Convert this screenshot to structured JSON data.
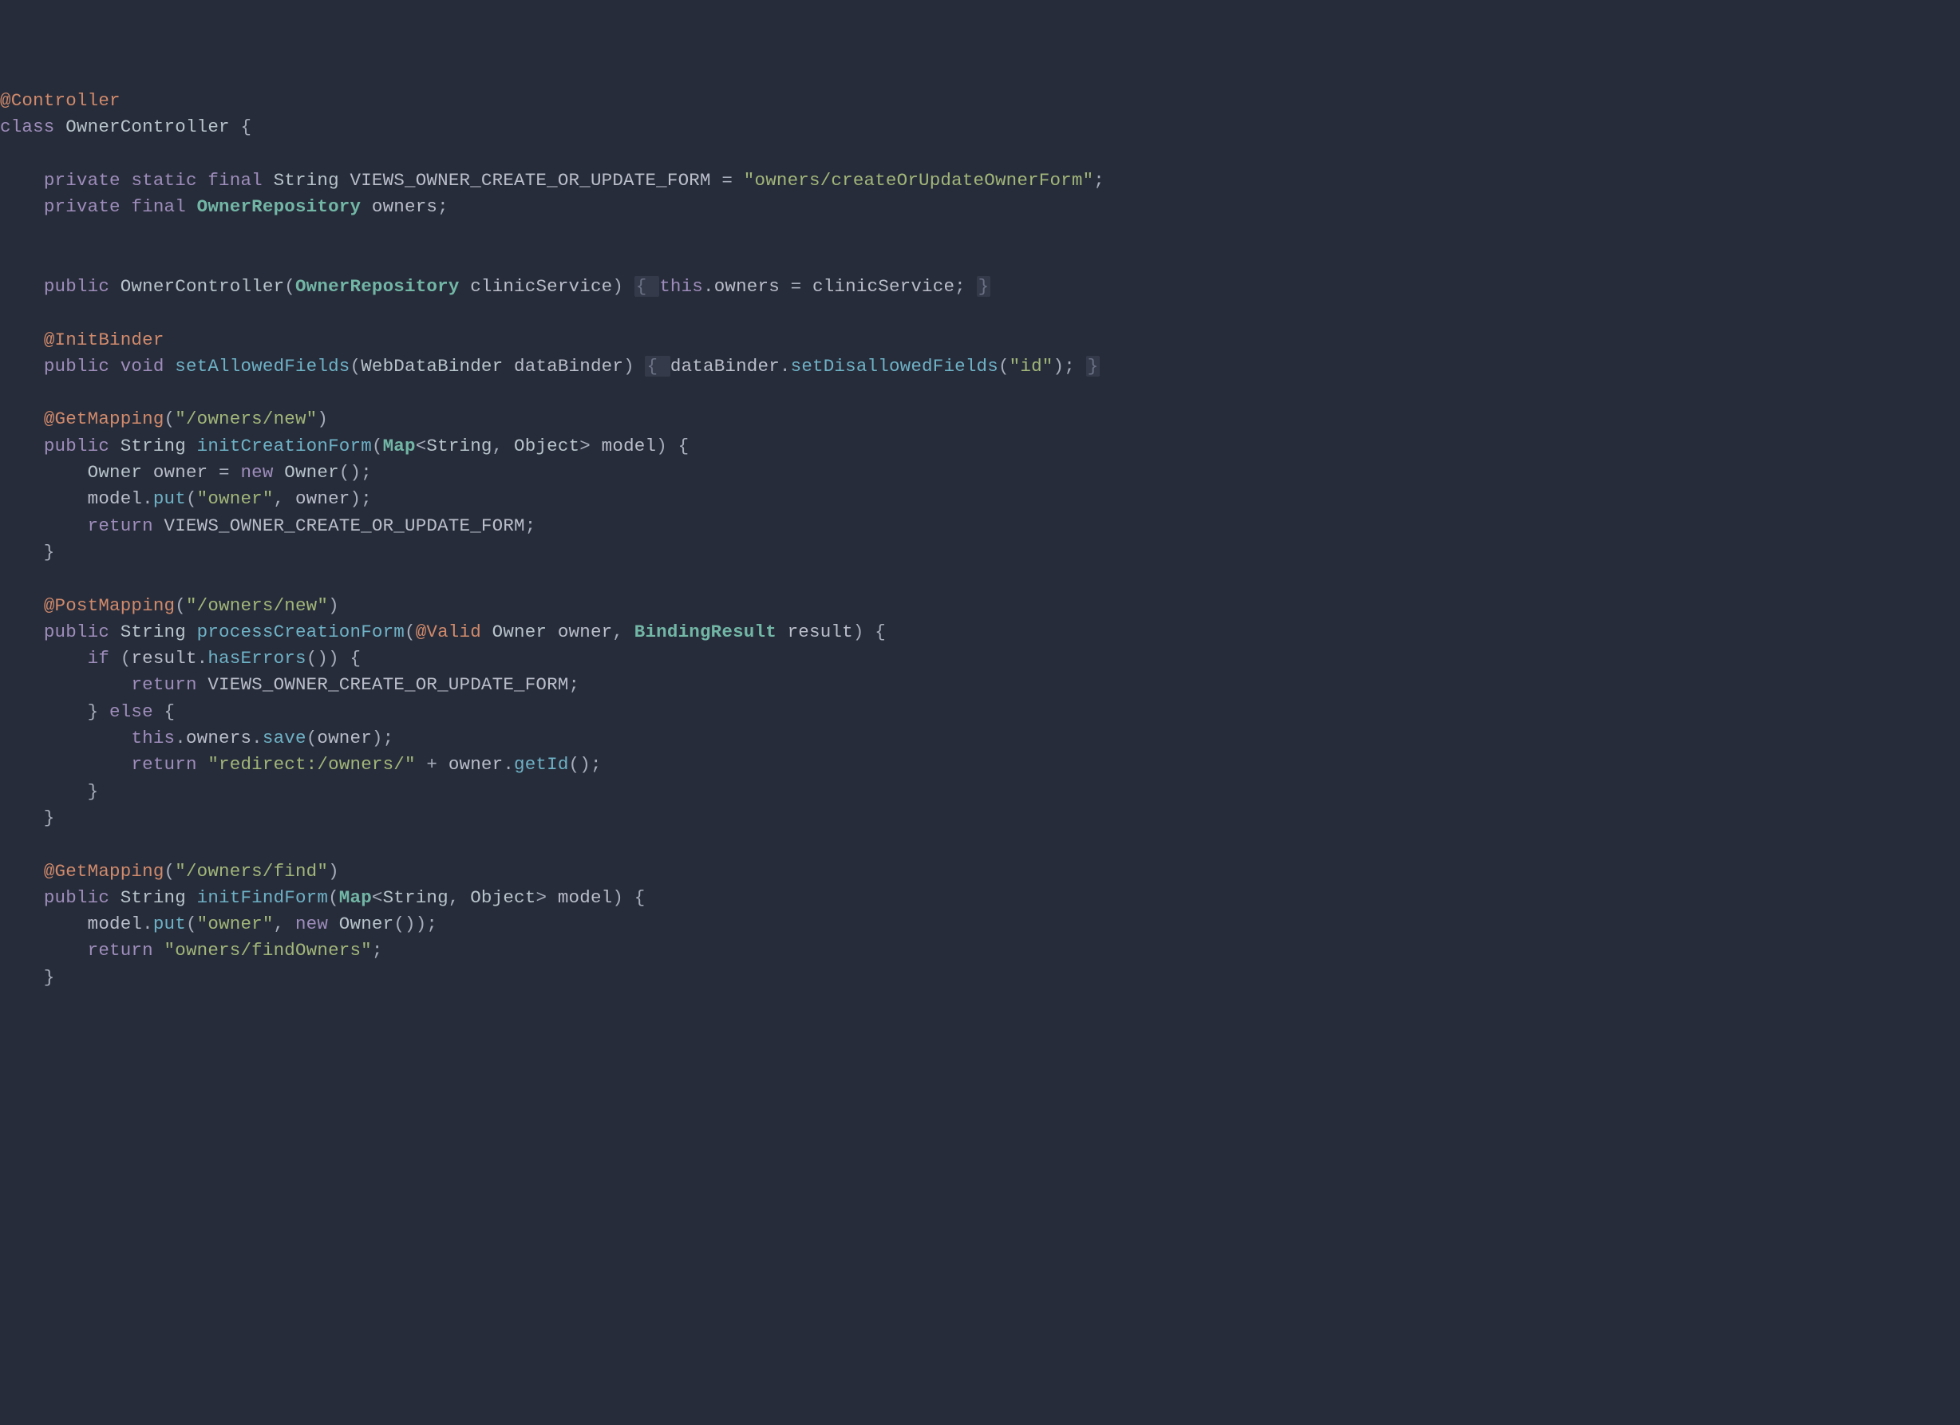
{
  "tokens": [
    [
      [
        "annotation",
        "@Controller"
      ]
    ],
    [
      [
        "keyword",
        "class"
      ],
      [
        "punct",
        " "
      ],
      [
        "type",
        "OwnerController"
      ],
      [
        "punct",
        " {"
      ]
    ],
    [],
    [
      [
        "punct",
        "    "
      ],
      [
        "keyword",
        "private"
      ],
      [
        "punct",
        " "
      ],
      [
        "keyword",
        "static"
      ],
      [
        "punct",
        " "
      ],
      [
        "keyword",
        "final"
      ],
      [
        "punct",
        " "
      ],
      [
        "type",
        "String"
      ],
      [
        "punct",
        " "
      ],
      [
        "identifier",
        "VIEWS_OWNER_CREATE_OR_UPDATE_FORM"
      ],
      [
        "punct",
        " = "
      ],
      [
        "string",
        "\"owners/createOrUpdateOwnerForm\""
      ],
      [
        "punct",
        ";"
      ]
    ],
    [
      [
        "punct",
        "    "
      ],
      [
        "keyword",
        "private"
      ],
      [
        "punct",
        " "
      ],
      [
        "keyword",
        "final"
      ],
      [
        "punct",
        " "
      ],
      [
        "type-emph",
        "OwnerRepository"
      ],
      [
        "punct",
        " "
      ],
      [
        "identifier",
        "owners"
      ],
      [
        "punct",
        ";"
      ]
    ],
    [],
    [],
    [
      [
        "punct",
        "    "
      ],
      [
        "keyword",
        "public"
      ],
      [
        "punct",
        " "
      ],
      [
        "type",
        "OwnerController"
      ],
      [
        "paren",
        "("
      ],
      [
        "type-emph",
        "OwnerRepository"
      ],
      [
        "punct",
        " "
      ],
      [
        "identifier",
        "clinicService"
      ],
      [
        "paren",
        ")"
      ],
      [
        "punct",
        " "
      ],
      [
        "collapsed-open",
        "{ "
      ],
      [
        "keyword",
        "this"
      ],
      [
        "punct",
        "."
      ],
      [
        "identifier",
        "owners"
      ],
      [
        "punct",
        " = "
      ],
      [
        "identifier",
        "clinicService"
      ],
      [
        "punct",
        "; "
      ],
      [
        "collapsed-close",
        "}"
      ]
    ],
    [],
    [
      [
        "punct",
        "    "
      ],
      [
        "annotation",
        "@InitBinder"
      ]
    ],
    [
      [
        "punct",
        "    "
      ],
      [
        "keyword",
        "public"
      ],
      [
        "punct",
        " "
      ],
      [
        "keyword",
        "void"
      ],
      [
        "punct",
        " "
      ],
      [
        "method",
        "setAllowedFields"
      ],
      [
        "paren",
        "("
      ],
      [
        "type",
        "WebDataBinder"
      ],
      [
        "punct",
        " "
      ],
      [
        "identifier",
        "dataBinder"
      ],
      [
        "paren",
        ")"
      ],
      [
        "punct",
        " "
      ],
      [
        "collapsed-open",
        "{ "
      ],
      [
        "identifier",
        "dataBinder"
      ],
      [
        "punct",
        "."
      ],
      [
        "method",
        "setDisallowedFields"
      ],
      [
        "paren",
        "("
      ],
      [
        "string",
        "\"id\""
      ],
      [
        "paren",
        ")"
      ],
      [
        "punct",
        "; "
      ],
      [
        "collapsed-close",
        "}"
      ]
    ],
    [],
    [
      [
        "punct",
        "    "
      ],
      [
        "annotation",
        "@GetMapping"
      ],
      [
        "paren",
        "("
      ],
      [
        "string",
        "\"/owners/new\""
      ],
      [
        "paren",
        ")"
      ]
    ],
    [
      [
        "punct",
        "    "
      ],
      [
        "keyword",
        "public"
      ],
      [
        "punct",
        " "
      ],
      [
        "type",
        "String"
      ],
      [
        "punct",
        " "
      ],
      [
        "method",
        "initCreationForm"
      ],
      [
        "paren",
        "("
      ],
      [
        "type-emph",
        "Map"
      ],
      [
        "punct",
        "<"
      ],
      [
        "type",
        "String"
      ],
      [
        "punct",
        ", "
      ],
      [
        "type",
        "Object"
      ],
      [
        "punct",
        "> "
      ],
      [
        "identifier",
        "model"
      ],
      [
        "paren",
        ")"
      ],
      [
        "punct",
        " {"
      ]
    ],
    [
      [
        "punct",
        "        "
      ],
      [
        "type",
        "Owner"
      ],
      [
        "punct",
        " "
      ],
      [
        "identifier",
        "owner"
      ],
      [
        "punct",
        " = "
      ],
      [
        "keyword",
        "new"
      ],
      [
        "punct",
        " "
      ],
      [
        "type",
        "Owner"
      ],
      [
        "paren",
        "()"
      ],
      [
        "punct",
        ";"
      ]
    ],
    [
      [
        "punct",
        "        "
      ],
      [
        "identifier",
        "model"
      ],
      [
        "punct",
        "."
      ],
      [
        "method",
        "put"
      ],
      [
        "paren",
        "("
      ],
      [
        "string",
        "\"owner\""
      ],
      [
        "punct",
        ", "
      ],
      [
        "identifier",
        "owner"
      ],
      [
        "paren",
        ")"
      ],
      [
        "punct",
        ";"
      ]
    ],
    [
      [
        "punct",
        "        "
      ],
      [
        "keyword",
        "return"
      ],
      [
        "punct",
        " "
      ],
      [
        "identifier",
        "VIEWS_OWNER_CREATE_OR_UPDATE_FORM"
      ],
      [
        "punct",
        ";"
      ]
    ],
    [
      [
        "punct",
        "    }"
      ]
    ],
    [],
    [
      [
        "punct",
        "    "
      ],
      [
        "annotation",
        "@PostMapping"
      ],
      [
        "paren",
        "("
      ],
      [
        "string",
        "\"/owners/new\""
      ],
      [
        "paren",
        ")"
      ]
    ],
    [
      [
        "punct",
        "    "
      ],
      [
        "keyword",
        "public"
      ],
      [
        "punct",
        " "
      ],
      [
        "type",
        "String"
      ],
      [
        "punct",
        " "
      ],
      [
        "method",
        "processCreationForm"
      ],
      [
        "paren",
        "("
      ],
      [
        "annotation",
        "@Valid"
      ],
      [
        "punct",
        " "
      ],
      [
        "type",
        "Owner"
      ],
      [
        "punct",
        " "
      ],
      [
        "identifier",
        "owner"
      ],
      [
        "punct",
        ", "
      ],
      [
        "type-emph",
        "BindingResult"
      ],
      [
        "punct",
        " "
      ],
      [
        "identifier",
        "result"
      ],
      [
        "paren",
        ")"
      ],
      [
        "punct",
        " {"
      ]
    ],
    [
      [
        "punct",
        "        "
      ],
      [
        "keyword",
        "if"
      ],
      [
        "punct",
        " "
      ],
      [
        "paren",
        "("
      ],
      [
        "identifier",
        "result"
      ],
      [
        "punct",
        "."
      ],
      [
        "method",
        "hasErrors"
      ],
      [
        "paren",
        "()"
      ],
      [
        "paren",
        ")"
      ],
      [
        "punct",
        " {"
      ]
    ],
    [
      [
        "punct",
        "            "
      ],
      [
        "keyword",
        "return"
      ],
      [
        "punct",
        " "
      ],
      [
        "identifier",
        "VIEWS_OWNER_CREATE_OR_UPDATE_FORM"
      ],
      [
        "punct",
        ";"
      ]
    ],
    [
      [
        "punct",
        "        } "
      ],
      [
        "keyword",
        "else"
      ],
      [
        "punct",
        " {"
      ]
    ],
    [
      [
        "punct",
        "            "
      ],
      [
        "keyword",
        "this"
      ],
      [
        "punct",
        "."
      ],
      [
        "identifier",
        "owners"
      ],
      [
        "punct",
        "."
      ],
      [
        "method",
        "save"
      ],
      [
        "paren",
        "("
      ],
      [
        "identifier",
        "owner"
      ],
      [
        "paren",
        ")"
      ],
      [
        "punct",
        ";"
      ]
    ],
    [
      [
        "punct",
        "            "
      ],
      [
        "keyword",
        "return"
      ],
      [
        "punct",
        " "
      ],
      [
        "string",
        "\"redirect:/owners/\""
      ],
      [
        "punct",
        " + "
      ],
      [
        "identifier",
        "owner"
      ],
      [
        "punct",
        "."
      ],
      [
        "method",
        "getId"
      ],
      [
        "paren",
        "()"
      ],
      [
        "punct",
        ";"
      ]
    ],
    [
      [
        "punct",
        "        }"
      ]
    ],
    [
      [
        "punct",
        "    }"
      ]
    ],
    [],
    [
      [
        "punct",
        "    "
      ],
      [
        "annotation",
        "@GetMapping"
      ],
      [
        "paren",
        "("
      ],
      [
        "string",
        "\"/owners/find\""
      ],
      [
        "paren",
        ")"
      ]
    ],
    [
      [
        "punct",
        "    "
      ],
      [
        "keyword",
        "public"
      ],
      [
        "punct",
        " "
      ],
      [
        "type",
        "String"
      ],
      [
        "punct",
        " "
      ],
      [
        "method",
        "initFindForm"
      ],
      [
        "paren",
        "("
      ],
      [
        "type-emph",
        "Map"
      ],
      [
        "punct",
        "<"
      ],
      [
        "type",
        "String"
      ],
      [
        "punct",
        ", "
      ],
      [
        "type",
        "Object"
      ],
      [
        "punct",
        "> "
      ],
      [
        "identifier",
        "model"
      ],
      [
        "paren",
        ")"
      ],
      [
        "punct",
        " {"
      ]
    ],
    [
      [
        "punct",
        "        "
      ],
      [
        "identifier",
        "model"
      ],
      [
        "punct",
        "."
      ],
      [
        "method",
        "put"
      ],
      [
        "paren",
        "("
      ],
      [
        "string",
        "\"owner\""
      ],
      [
        "punct",
        ", "
      ],
      [
        "keyword",
        "new"
      ],
      [
        "punct",
        " "
      ],
      [
        "type",
        "Owner"
      ],
      [
        "paren",
        "()"
      ],
      [
        "paren",
        ")"
      ],
      [
        "punct",
        ";"
      ]
    ],
    [
      [
        "punct",
        "        "
      ],
      [
        "keyword",
        "return"
      ],
      [
        "punct",
        " "
      ],
      [
        "string",
        "\"owners/findOwners\""
      ],
      [
        "punct",
        ";"
      ]
    ],
    [
      [
        "punct",
        "    }"
      ]
    ]
  ]
}
